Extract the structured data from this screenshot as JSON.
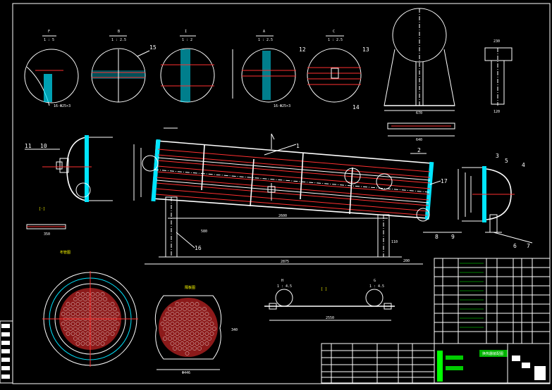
{
  "section_views": {
    "F": {
      "letter": "F",
      "scale": "1 : 5",
      "size_label": "16-Φ25×3"
    },
    "B": {
      "letter": "B",
      "scale": "1 : 2.5"
    },
    "J": {
      "letter": "I",
      "scale": "1 : 2"
    },
    "A": {
      "letter": "A",
      "scale": "1 : 2.5",
      "size_label": "16-Φ25×3"
    },
    "C": {
      "letter": "C",
      "scale": "1 : 2.5"
    }
  },
  "part_numbers": [
    "1",
    "2",
    "3",
    "4",
    "5",
    "6",
    "7",
    "8",
    "9",
    "10",
    "11",
    "12",
    "13",
    "14",
    "15",
    "16",
    "17"
  ],
  "main_view": {
    "dim_length": "2600",
    "dim_total": "2875",
    "dim_support": "580",
    "dim_right": "200",
    "dim_left": "110"
  },
  "saddle_view": {
    "dim_width": "670",
    "dim_base": "640"
  },
  "support_side": {
    "dim_top": "230",
    "dim_bottom": "120"
  },
  "tube_layout": {
    "label_left": "布管图",
    "label_right": "隔板图",
    "dim_width": "Φ446",
    "dim_height": "340"
  },
  "baffle_view": {
    "letter_h": "H",
    "letter_g": "G",
    "scale_h": "1 : 4.5",
    "scale_g": "1 : 4.5",
    "dim_length": "2550"
  },
  "left_notes": {
    "dim": "350"
  },
  "title_block": {
    "drawing_title": "换热器装配图"
  }
}
